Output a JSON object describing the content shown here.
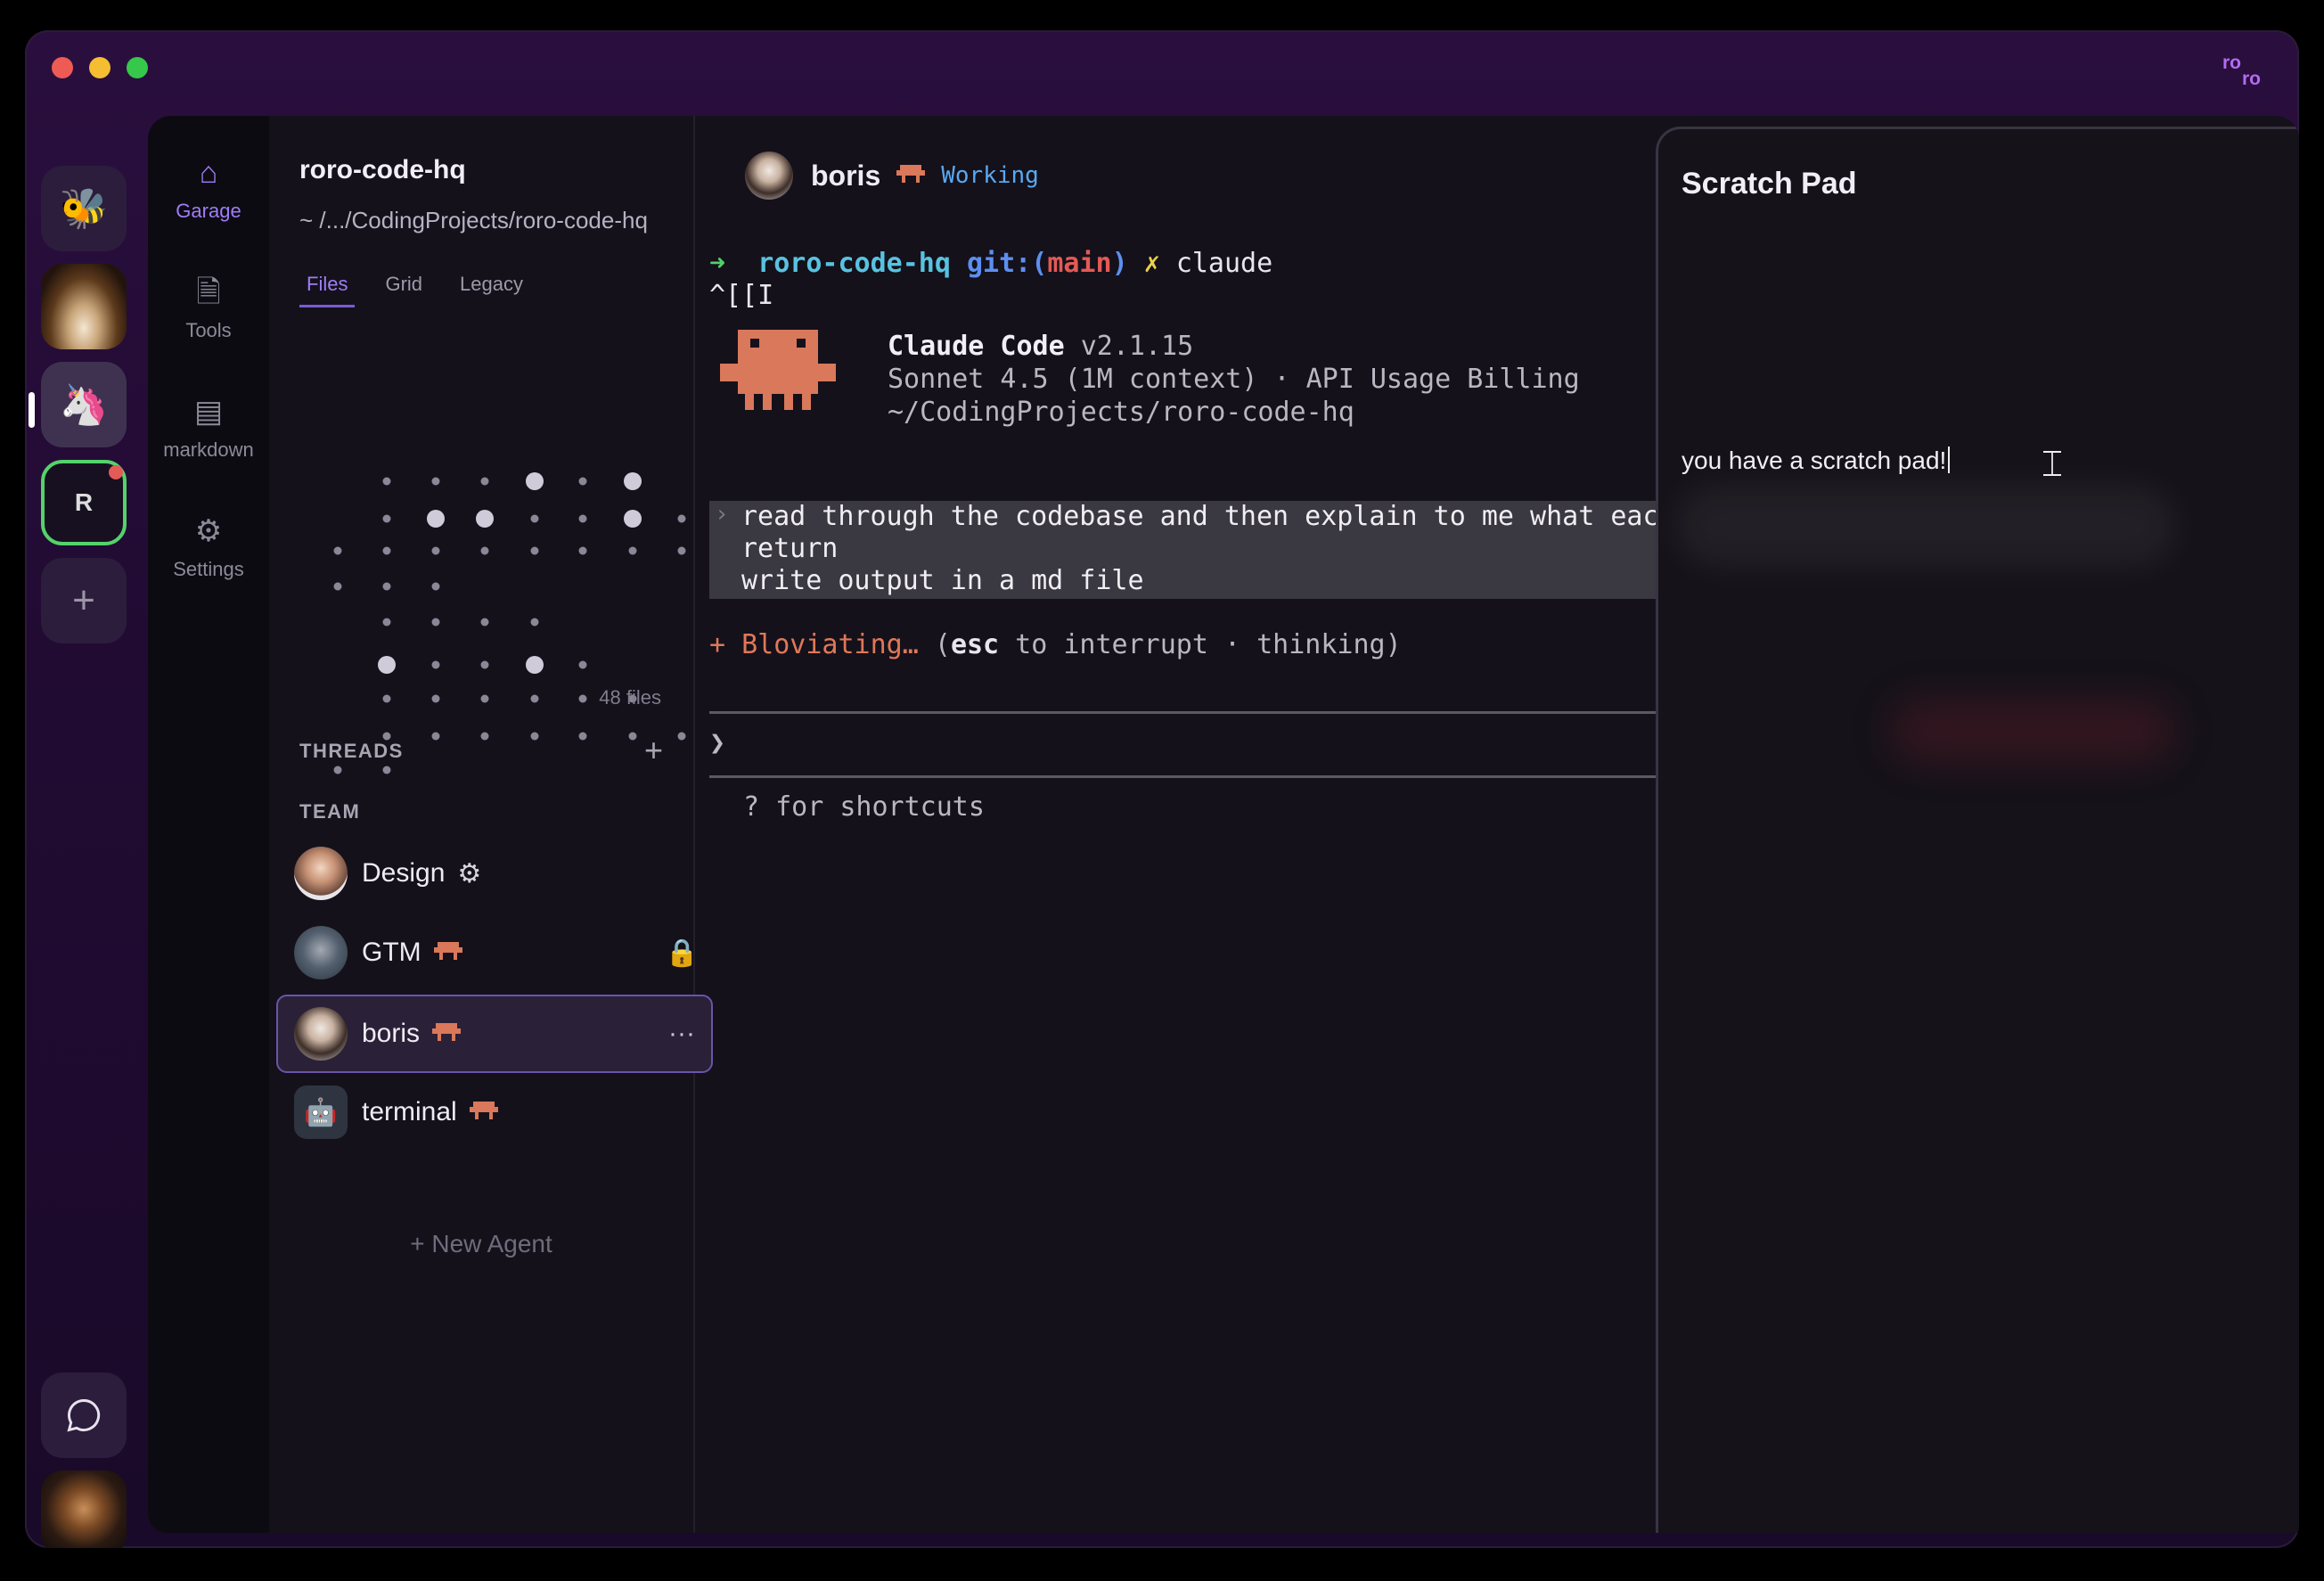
{
  "window": {
    "brand": [
      "ro",
      "ro"
    ]
  },
  "rail": {
    "items": [
      {
        "name": "bee-app",
        "glyph": "🐝"
      },
      {
        "name": "forest-app"
      },
      {
        "name": "unicorn-app",
        "glyph": "🦄"
      },
      {
        "name": "workspace-r",
        "label": "R"
      },
      {
        "name": "add",
        "glyph": "+"
      }
    ],
    "chat_glyph": "💬"
  },
  "nav": [
    {
      "label": "Garage",
      "icon": "home-icon",
      "glyph": "⌂",
      "active": true
    },
    {
      "label": "Tools",
      "icon": "document-icon",
      "glyph": "🗎"
    },
    {
      "label": "markdown",
      "icon": "layout-icon",
      "glyph": "▤"
    },
    {
      "label": "Settings",
      "icon": "gear-icon",
      "glyph": "⚙"
    }
  ],
  "sidebar": {
    "project_name": "roro-code-hq",
    "project_path": "~ /.../CodingProjects/roro-code-hq",
    "tabs": [
      "Files",
      "Grid",
      "Legacy"
    ],
    "files_count": "48 files",
    "threads_label": "THREADS",
    "threads_add": "+",
    "team_label": "TEAM",
    "agents": [
      {
        "name": "Design",
        "badge": "⚙",
        "extra": ""
      },
      {
        "name": "GTM",
        "badge": "crab",
        "extra": "🔒"
      },
      {
        "name": "boris",
        "badge": "crab",
        "extra": "···"
      },
      {
        "name": "terminal",
        "badge": "crab",
        "extra": ""
      }
    ],
    "new_agent": "+  New Agent"
  },
  "terminal": {
    "agent_name": "boris",
    "status": "Working",
    "cmd": {
      "arrow": "➜",
      "dir": "roro-code-hq",
      "git_open": "git:(",
      "branch": "main",
      "git_close": ")",
      "x": "✗",
      "command": "claude"
    },
    "esc_seq": "^[[I",
    "cc_title": "Claude Code",
    "cc_version": "v2.1.15",
    "cc_model": "Sonnet 4.5 (1M context) · API Usage Billing",
    "cc_path": "~/CodingProjects/roro-code-hq",
    "prompt_lines": [
      "read through the codebase and then explain to me what each",
      "return",
      "write output in a md file"
    ],
    "status_star": "+",
    "status_word": "Bloviating…",
    "status_hint_open": "(",
    "status_key": "esc",
    "status_hint_rest": " to interrupt · thinking)",
    "input_prompt": "❯",
    "shortcuts": "? for shortcuts"
  },
  "scratch": {
    "title": "Scratch Pad",
    "text": "you have a scratch pad!"
  }
}
